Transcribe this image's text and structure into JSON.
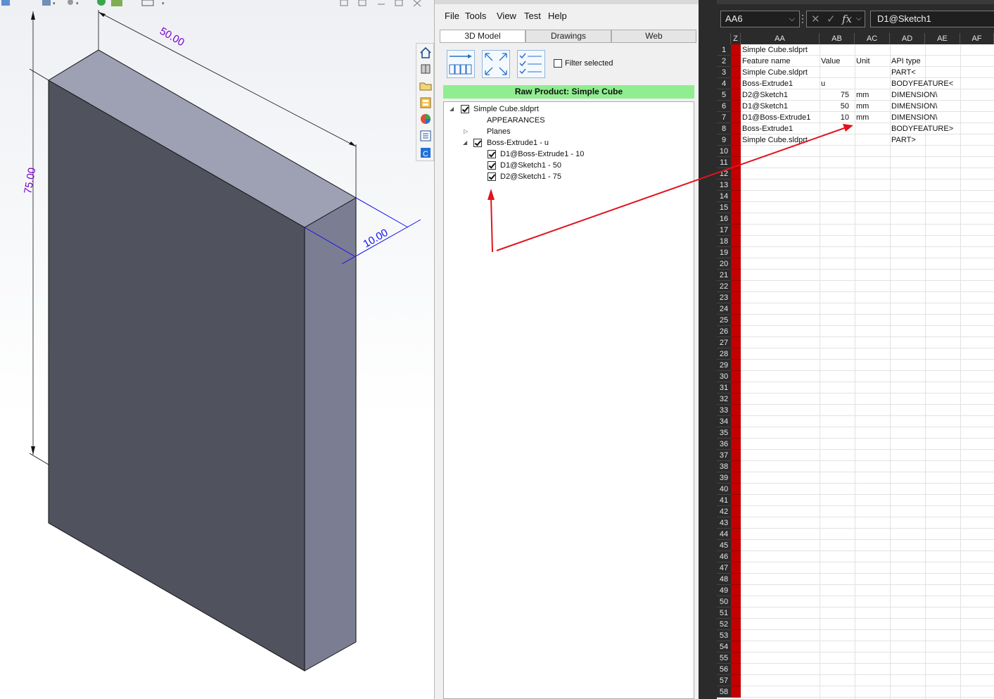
{
  "viewport": {
    "dimensions": {
      "width_label": "50.00",
      "height_label": "75.00",
      "depth_label": "10.00"
    },
    "colors": {
      "dimension": "#7a00cc",
      "selected_dimension": "#1010ee",
      "front_face": "#50525e",
      "top_face": "#9ea0b4",
      "side_face": "#7b7d92"
    }
  },
  "panel": {
    "menu": [
      "File",
      "Tools",
      "View",
      "Test",
      "Help"
    ],
    "tabs": [
      "3D Model",
      "Drawings",
      "Web"
    ],
    "active_tab": "3D Model",
    "filter_label": "Filter selected",
    "product_label": "Raw Product: Simple Cube",
    "tree": [
      {
        "label": "Simple Cube.sldprt",
        "checked": true,
        "expanded": true
      },
      {
        "label": "APPEARANCES"
      },
      {
        "label": "Planes",
        "expanded": false
      },
      {
        "label": "Boss-Extrude1 - u",
        "checked": true,
        "expanded": true
      },
      {
        "label": "D1@Boss-Extrude1 - 10",
        "checked": true
      },
      {
        "label": "D1@Sketch1 - 50",
        "checked": true
      },
      {
        "label": "D2@Sketch1 - 75",
        "checked": true
      }
    ]
  },
  "spreadsheet": {
    "name_box": "AA6",
    "formula": "D1@Sketch1",
    "fx_label": "fx",
    "columns": [
      "Z",
      "AA",
      "AB",
      "AC",
      "AD",
      "AE",
      "AF"
    ],
    "rows": [
      {
        "aa": "Simple Cube.sldprt",
        "ab": "",
        "ac": "",
        "ad": ""
      },
      {
        "aa": "Feature name",
        "ab": "Value",
        "ac": "Unit",
        "ad": "API type"
      },
      {
        "aa": "Simple Cube.sldprt",
        "ab": "",
        "ac": "",
        "ad": "PART<"
      },
      {
        "aa": "Boss-Extrude1",
        "ab": "u",
        "ac": "",
        "ad": "BODYFEATURE<"
      },
      {
        "aa": "D2@Sketch1",
        "ab": "75",
        "ac": "mm",
        "ad": "DIMENSION\\"
      },
      {
        "aa": "D1@Sketch1",
        "ab": "50",
        "ac": "mm",
        "ad": "DIMENSION\\"
      },
      {
        "aa": "D1@Boss-Extrude1",
        "ab": "10",
        "ac": "mm",
        "ad": "DIMENSION\\"
      },
      {
        "aa": "Boss-Extrude1",
        "ab": "",
        "ac": "",
        "ad": "BODYFEATURE>"
      },
      {
        "aa": "Simple Cube.sldprt",
        "ab": "",
        "ac": "",
        "ad": "PART>"
      }
    ],
    "row_numbers": [
      "1",
      "2",
      "3",
      "4",
      "5",
      "6",
      "7",
      "8",
      "9",
      "10",
      "11",
      "12",
      "13",
      "14",
      "15",
      "16",
      "17",
      "18",
      "19",
      "20",
      "21",
      "22",
      "23",
      "24",
      "25",
      "26",
      "27",
      "28",
      "29",
      "30",
      "31",
      "32",
      "33",
      "34",
      "35",
      "36",
      "37",
      "38",
      "39",
      "40",
      "41",
      "42",
      "43",
      "44",
      "45",
      "46",
      "47",
      "48",
      "49",
      "50",
      "51",
      "52",
      "53",
      "54",
      "55",
      "56",
      "57",
      "58"
    ]
  }
}
